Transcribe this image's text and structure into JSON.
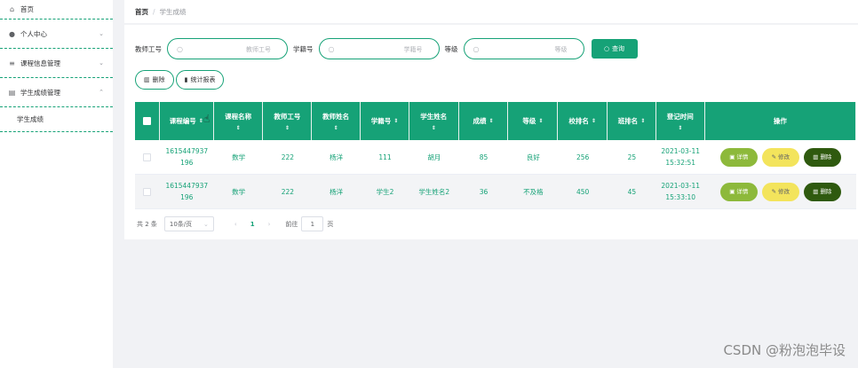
{
  "sidebar": {
    "items": [
      {
        "label": "首页",
        "icon": "home-icon"
      },
      {
        "label": "个人中心",
        "icon": "user-icon",
        "arrow": "⌄"
      },
      {
        "label": "课程信息管理",
        "icon": "list-icon",
        "arrow": "⌄"
      },
      {
        "label": "学生成绩管理",
        "icon": "clipboard-icon",
        "arrow": "⌃"
      }
    ],
    "subitem": "学生成绩"
  },
  "breadcrumb": {
    "home": "首页",
    "sep": "/",
    "current": "学生成绩"
  },
  "search": {
    "teacher_label": "教师工号",
    "teacher_placeholder": "教师工号",
    "student_label": "学籍号",
    "student_placeholder": "学籍号",
    "grade_label": "等级",
    "grade_placeholder": "等级",
    "button": "查询"
  },
  "actions": {
    "delete": "删除",
    "report": "统计报表"
  },
  "table": {
    "headers": [
      "课程编号",
      "课程名称",
      "教师工号",
      "教师姓名",
      "学籍号",
      "学生姓名",
      "成绩",
      "等级",
      "校排名",
      "班排名",
      "登记时间",
      "操作"
    ],
    "rows": [
      {
        "course_id": "1615447937196",
        "course_name": "数学",
        "teacher_id": "222",
        "teacher_name": "杨洋",
        "student_no": "111",
        "student_name": "胡月",
        "score": "85",
        "grade": "良好",
        "school_rank": "256",
        "class_rank": "25",
        "time": "2021-03-11 15:32:51"
      },
      {
        "course_id": "1615447937196",
        "course_name": "数学",
        "teacher_id": "222",
        "teacher_name": "杨洋",
        "student_no": "学生2",
        "student_name": "学生姓名2",
        "score": "36",
        "grade": "不及格",
        "school_rank": "450",
        "class_rank": "45",
        "time": "2021-03-11 15:33:10"
      }
    ],
    "op": {
      "detail": "详情",
      "edit": "修改",
      "delete": "删除"
    }
  },
  "pager": {
    "total": "共 2 条",
    "size": "10条/页",
    "page": "1",
    "goto": "前往",
    "goto_value": "1",
    "unit": "页"
  },
  "watermark": "CSDN @粉泡泡毕设",
  "colors": {
    "accent": "#16a277",
    "detail": "#8db93b",
    "edit": "#f3e45c",
    "delete": "#2f5a0f"
  }
}
